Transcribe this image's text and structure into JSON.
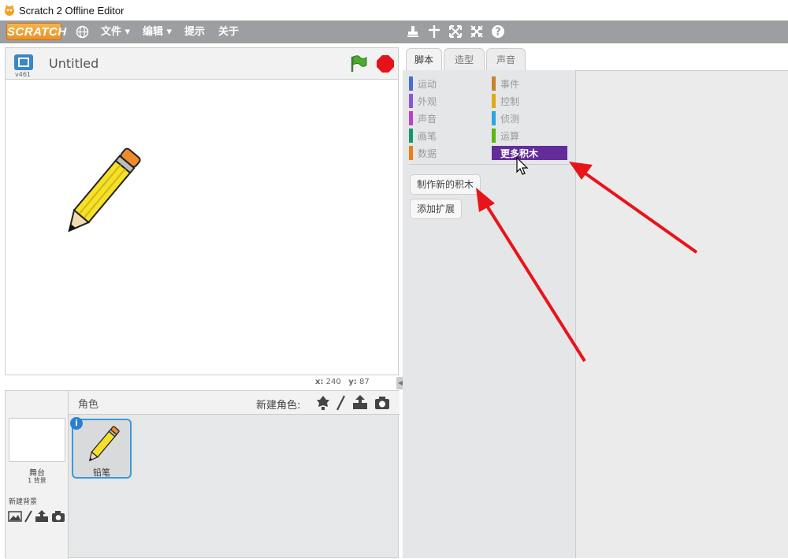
{
  "window": {
    "title": "Scratch 2 Offline Editor"
  },
  "menubar": {
    "logo": "SCRATCH",
    "items": [
      "文件 ▾",
      "编辑 ▾",
      "提示",
      "关于"
    ]
  },
  "stage": {
    "project_title": "Untitled",
    "version": "v461",
    "coords": {
      "x_label": "x:",
      "x_value": "240",
      "y_label": "y:",
      "y_value": "87"
    }
  },
  "sprites": {
    "header_label": "角色",
    "new_sprite_label": "新建角色:",
    "stage_name": "舞台",
    "stage_backdrops": "1 背景",
    "new_backdrop_label": "新建背景",
    "items": [
      {
        "name": "铅笔",
        "info": "i"
      }
    ]
  },
  "tabs": [
    "脚本",
    "造型",
    "声音"
  ],
  "palette": {
    "categories_left": [
      {
        "label": "运动",
        "color": "#4a6cd4"
      },
      {
        "label": "外观",
        "color": "#8a55d7"
      },
      {
        "label": "声音",
        "color": "#bb42c3"
      },
      {
        "label": "画笔",
        "color": "#0e9a6c"
      },
      {
        "label": "数据",
        "color": "#ee7d16"
      }
    ],
    "categories_right": [
      {
        "label": "事件",
        "color": "#c88330"
      },
      {
        "label": "控制",
        "color": "#e1a91a"
      },
      {
        "label": "侦测",
        "color": "#2ca5e2"
      },
      {
        "label": "运算",
        "color": "#5cb712"
      },
      {
        "label": "更多积木",
        "color": "#632d99"
      }
    ],
    "buttons": [
      "制作新的积木",
      "添加扩展"
    ]
  },
  "colors": {
    "menubar": "#9c9ea2",
    "accent_selected": "#632d99",
    "arrow": "#e8141a"
  }
}
